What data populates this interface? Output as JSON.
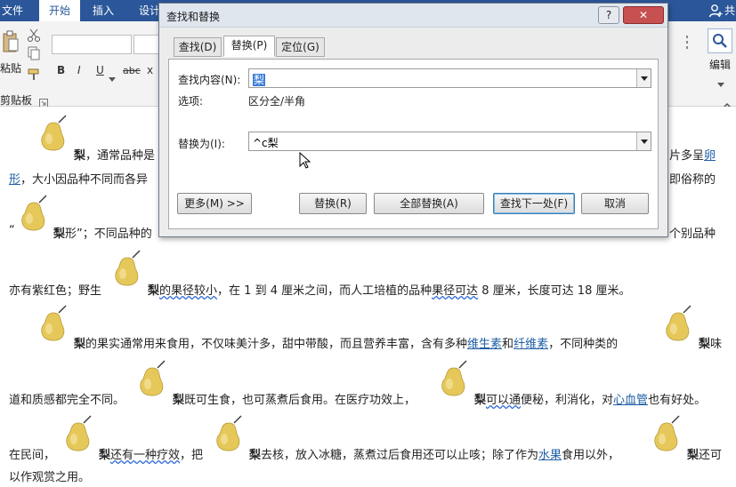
{
  "ribbon": {
    "tabs": [
      "文件",
      "开始",
      "插入",
      "设计"
    ],
    "share": "共",
    "paste_label": "粘贴",
    "clipboard_group": "剪贴板",
    "edit_label": "编辑",
    "font_buttons": [
      "B",
      "I",
      "U",
      "abc",
      "x"
    ]
  },
  "document": {
    "line1": {
      "bold": "梨",
      "text": "，通常品种是",
      "tail": "片多呈",
      "tail_link": "卵"
    },
    "line2": {
      "link": "形",
      "text": "，大小因品种不同而各异",
      "tail": "即俗称的"
    },
    "line3": {
      "quote": "“",
      "bold": "梨",
      "text": "形”；不同品种的",
      "tail": "个别品种"
    },
    "line4": {
      "text1": "亦有紫红色；野生",
      "bold": "梨",
      "wavy": "的果径较小",
      "text2": "，在 1 到 4 厘米之间，而人工培植的品种",
      "wavy2": "果径可达",
      "text3": " 8 厘米，长度可达 18 厘米。"
    },
    "line5": {
      "bold": "梨",
      "text1": "的果实通常用来食用，不仅味美汁多，甜中带酸，而且营养丰富，含有多种",
      "link1": "维生素",
      "text2": "和",
      "link2": "纤维素",
      "text3": "，不同种类的",
      "bold2": "梨",
      "tail": "味"
    },
    "line6": {
      "text1": "道和质感都完全不同。",
      "bold": "梨",
      "text2": "既可生食，也可蒸煮后食用。在医疗功效上，",
      "bold2": "梨",
      "wavy": "可以通",
      "text3": "便秘，利消化，对",
      "link": "心血管",
      "text4": "也有好处。"
    },
    "line7": {
      "text1": "在民间，",
      "bold": "梨",
      "wavy": "还有一种疗效",
      "text2": "，把",
      "bold2": "梨",
      "text3": "去核，放入冰糖，蒸煮过后食用还可以止咳；除了作为",
      "link": "水果",
      "text4": "食用以外，",
      "bold3": "梨",
      "tail": "还可"
    },
    "line8": {
      "text": "以作观赏之用。"
    }
  },
  "dialog": {
    "title": "查找和替换",
    "help": "?",
    "minimize": "–",
    "close": "✕",
    "tabs": [
      "查找(D)",
      "替换(P)",
      "定位(G)"
    ],
    "find_label": "查找内容(N):",
    "find_value": "梨",
    "options_label": "选项:",
    "options_value": "区分全/半角",
    "replace_label": "替换为(I):",
    "replace_value": "^c梨",
    "buttons": {
      "more": "更多(M) >>",
      "replace": "替换(R)",
      "replace_all": "全部替换(A)",
      "find_next": "查找下一处(F)",
      "cancel": "取消"
    }
  },
  "colors": {
    "ribbon_blue": "#2b579a",
    "link": "#1f5fa6",
    "pear_fill": "#e6c85a"
  }
}
